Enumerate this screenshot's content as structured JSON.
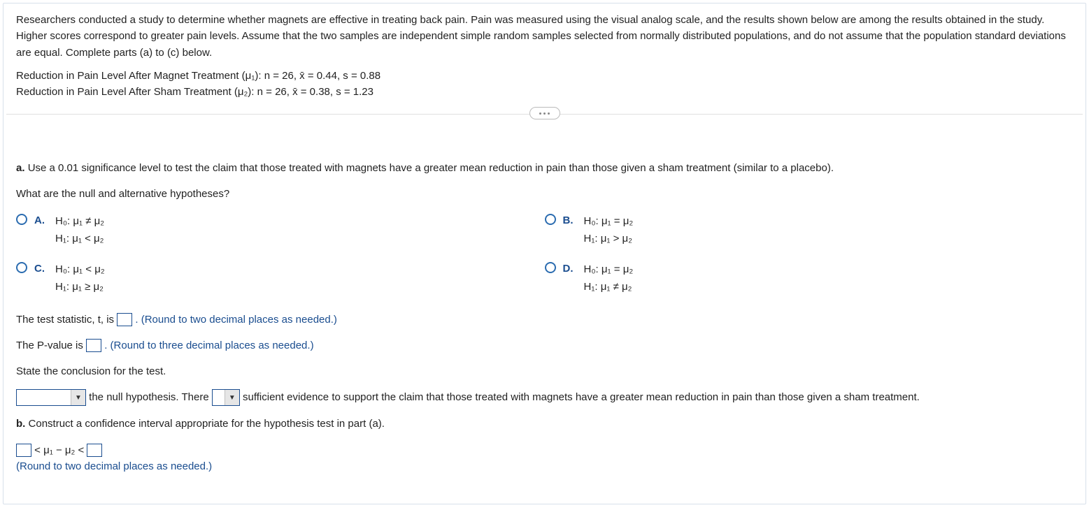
{
  "header": {
    "intro": "Researchers conducted a study to determine whether magnets are effective in treating back pain. Pain was measured using the visual analog scale, and the results shown below are among the results obtained in the study. Higher scores correspond to greater pain levels. Assume that the two samples are independent simple random samples selected from normally distributed populations, and do not assume that the population standard deviations are equal. Complete parts (a) to (c) below.",
    "line1": "Reduction in Pain Level After Magnet Treatment (μ₁): n = 26, x̄ = 0.44, s = 0.88",
    "line2": "Reduction in Pain Level After Sham Treatment (μ₂): n = 26, x̄ = 0.38, s = 1.23"
  },
  "partA": {
    "label": "a.",
    "text": "Use a 0.01 significance level to test the claim that those treated with magnets have a greater mean reduction in pain than those given a sham treatment (similar to a placebo).",
    "question": "What are the null and alternative hypotheses?",
    "options": {
      "A": {
        "letter": "A.",
        "l1": "H₀: μ₁ ≠ μ₂",
        "l2": "H₁: μ₁ < μ₂"
      },
      "B": {
        "letter": "B.",
        "l1": "H₀: μ₁ = μ₂",
        "l2": "H₁: μ₁ > μ₂"
      },
      "C": {
        "letter": "C.",
        "l1": "H₀: μ₁ < μ₂",
        "l2": "H₁: μ₁ ≥ μ₂"
      },
      "D": {
        "letter": "D.",
        "l1": "H₀: μ₁ = μ₂",
        "l2": "H₁: μ₁ ≠ μ₂"
      }
    },
    "tstat_pre": "The test statistic, t, is ",
    "tstat_hint": ". (Round to two decimal places as needed.)",
    "pval_pre": "The P-value is ",
    "pval_hint": ". (Round to three decimal places as needed.)",
    "conclusion_intro": "State the conclusion for the test.",
    "conclusion_mid1": " the null hypothesis. There ",
    "conclusion_mid2": " sufficient evidence to support the claim that those treated with magnets have a greater mean reduction in pain than those given a sham treatment."
  },
  "partB": {
    "label": "b.",
    "text": "Construct a confidence interval appropriate for the hypothesis test in part (a).",
    "ci_mid": " < μ₁ − μ₂ < ",
    "ci_hint": "(Round to two decimal places as needed.)"
  }
}
